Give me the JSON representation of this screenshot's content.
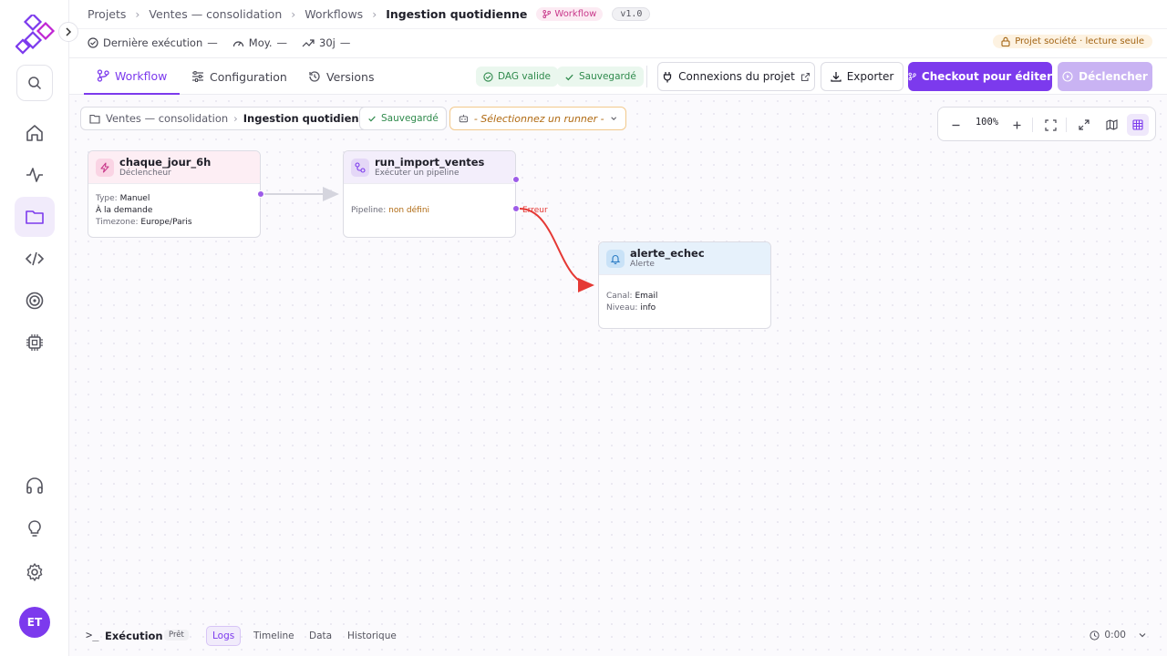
{
  "sidebar": {
    "avatar_initials": "ET",
    "items": [
      {
        "name": "home-icon"
      },
      {
        "name": "activity-icon"
      },
      {
        "name": "folder-icon"
      },
      {
        "name": "code-icon"
      },
      {
        "name": "target-icon"
      },
      {
        "name": "cpu-icon"
      },
      {
        "name": "headphones-icon"
      },
      {
        "name": "lightbulb-icon"
      },
      {
        "name": "settings-icon"
      }
    ]
  },
  "header": {
    "breadcrumb": [
      "Projets",
      "Ventes — consolidation",
      "Workflows",
      "Ingestion quotidienne"
    ],
    "type_badge": "Workflow",
    "version": "v1.0",
    "metrics": {
      "last_run_label": "Dernière exécution",
      "last_run_value": "—",
      "avg_label": "Moy.",
      "avg_value": "—",
      "trend_label": "30j",
      "trend_value": "—"
    },
    "readonly_badge": "Projet société · lecture seule"
  },
  "tabs": {
    "workflow": "Workflow",
    "configuration": "Configuration",
    "versions": "Versions",
    "dag_status": "DAG valide",
    "saved_status": "Sauvegardé",
    "connections_button": "Connexions du projet",
    "export_button": "Exporter",
    "checkout_button": "Checkout pour éditer",
    "trigger_button": "Déclencher"
  },
  "canvas": {
    "breadcrumb_project": "Ventes — consolidation",
    "breadcrumb_workflow": "Ingestion quotidienne",
    "saved": "Sauvegardé",
    "runner_placeholder": "- Sélectionnez un runner -",
    "zoom": "100%",
    "colors": {
      "accent": "#7c3aed",
      "error_edge": "#e53935",
      "edge": "#cfcfd8"
    }
  },
  "nodes": {
    "trigger": {
      "title": "chaque_jour_6h",
      "subtitle": "Déclencheur",
      "type_label": "Type:",
      "type_value": "Manuel",
      "schedule": "À la demande",
      "tz_label": "Timezone:",
      "tz_value": "Europe/Paris"
    },
    "pipeline": {
      "title": "run_import_ventes",
      "subtitle": "Exécuter un pipeline",
      "pipeline_label": "Pipeline:",
      "pipeline_value": "non défini",
      "error_label": "Erreur"
    },
    "alert": {
      "title": "alerte_echec",
      "subtitle": "Alerte",
      "channel_label": "Canal:",
      "channel_value": "Email",
      "level_label": "Niveau:",
      "level_value": "info"
    }
  },
  "execution": {
    "label": "Exécution",
    "status": "Prêt",
    "tabs": [
      "Logs",
      "Timeline",
      "Data",
      "Historique"
    ],
    "time": "0:00"
  }
}
